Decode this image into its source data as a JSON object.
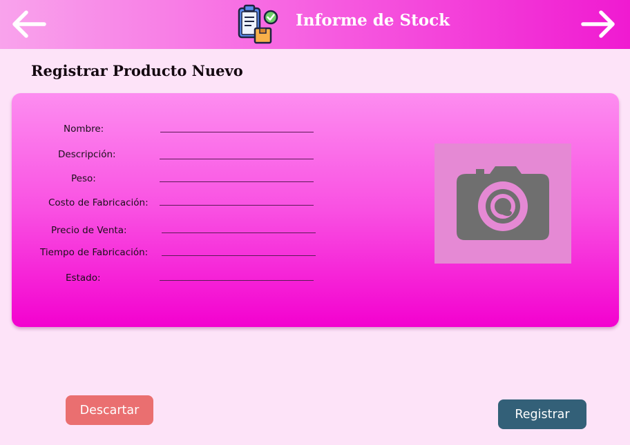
{
  "header": {
    "title": "Informe de Stock",
    "back_icon": "arrow-left-icon",
    "forward_icon": "arrow-right-icon",
    "app_icon": "clipboard-stock-icon"
  },
  "page": {
    "title": "Registrar Producto Nuevo"
  },
  "form": {
    "fields": [
      {
        "key": "nombre",
        "label": "Nombre:",
        "value": ""
      },
      {
        "key": "descripcion",
        "label": "Descripción:",
        "value": ""
      },
      {
        "key": "peso",
        "label": "Peso:",
        "value": ""
      },
      {
        "key": "costo",
        "label": "Costo de Fabricación:",
        "value": ""
      },
      {
        "key": "precio",
        "label": "Precio de Venta:",
        "value": ""
      },
      {
        "key": "tiempo",
        "label": "Tiempo de Fabricación:",
        "value": ""
      },
      {
        "key": "estado",
        "label": "Estado:",
        "value": ""
      }
    ],
    "photo_icon": "camera-icon"
  },
  "actions": {
    "discard_label": "Descartar",
    "register_label": "Registrar"
  },
  "colors": {
    "background": "#fde3f8",
    "header_gradient_end": "#f01ad1",
    "card_gradient_end": "#f301cf",
    "discard": "#ea6f70",
    "register": "#336078"
  }
}
